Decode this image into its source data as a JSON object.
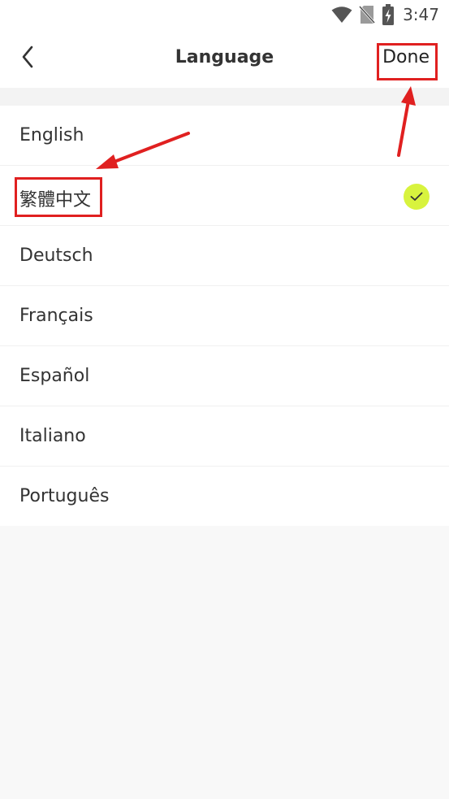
{
  "status_bar": {
    "time": "3:47",
    "icons": [
      "wifi-icon",
      "no-sim-icon",
      "battery-charging-icon"
    ]
  },
  "header": {
    "back_icon": "chevron-left-icon",
    "title": "Language",
    "done_label": "Done"
  },
  "languages": [
    {
      "label": "English",
      "selected": false
    },
    {
      "label": "繁體中文",
      "selected": true
    },
    {
      "label": "Deutsch",
      "selected": false
    },
    {
      "label": "Français",
      "selected": false
    },
    {
      "label": "Español",
      "selected": false
    },
    {
      "label": "Italiano",
      "selected": false
    },
    {
      "label": "Português",
      "selected": false
    }
  ],
  "selected_icon": "checkmark-icon",
  "colors": {
    "check_badge": "#d8f33e",
    "annotation": "#e02020"
  }
}
